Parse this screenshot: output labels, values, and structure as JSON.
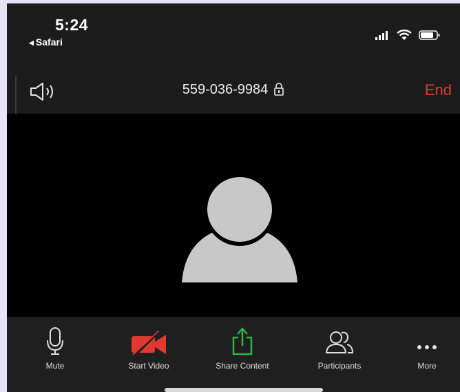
{
  "status_bar": {
    "time": "5:24",
    "back_app": "Safari",
    "icons": [
      "cellular-signal-icon",
      "wifi-icon",
      "battery-icon"
    ]
  },
  "call_header": {
    "speaker_icon": "speaker-icon",
    "meeting_id": "559-036-9984",
    "lock_icon": "lock-icon",
    "end_label": "End"
  },
  "video": {
    "participant_icon": "avatar-placeholder-icon"
  },
  "toolbar": {
    "items": [
      {
        "label": "Mute",
        "icon": "microphone-icon"
      },
      {
        "label": "Start Video",
        "icon": "video-off-icon"
      },
      {
        "label": "Share Content",
        "icon": "share-icon"
      },
      {
        "label": "Participants",
        "icon": "participants-icon"
      },
      {
        "label": "More",
        "icon": "more-icon"
      }
    ]
  },
  "colors": {
    "end": "#e03a2f",
    "video_off": "#e03a2f",
    "share": "#2db84a",
    "background": "#1c1c1c"
  }
}
